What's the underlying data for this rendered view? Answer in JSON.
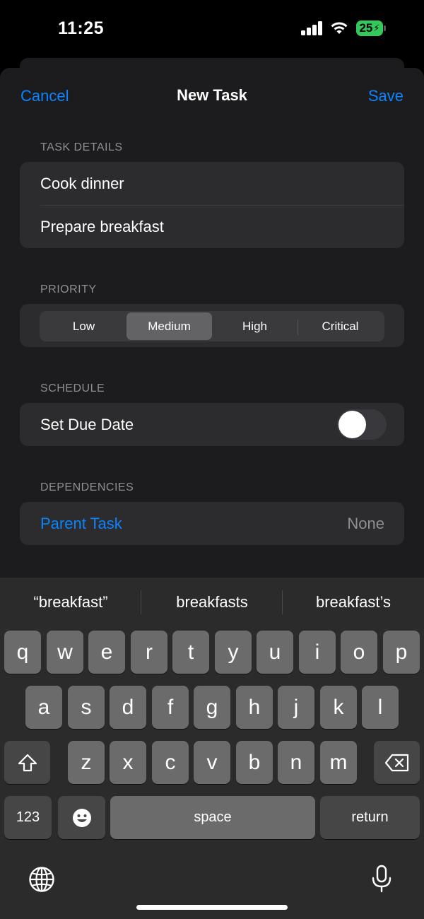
{
  "status": {
    "time": "11:25",
    "battery": "25"
  },
  "nav": {
    "cancel": "Cancel",
    "title": "New Task",
    "save": "Save"
  },
  "task_details": {
    "header": "TASK DETAILS",
    "fields": [
      "Cook dinner",
      "Prepare breakfast"
    ]
  },
  "priority": {
    "header": "PRIORITY",
    "options": [
      "Low",
      "Medium",
      "High",
      "Critical"
    ],
    "selected": "Medium"
  },
  "schedule": {
    "header": "SCHEDULE",
    "due_label": "Set Due Date",
    "due_enabled": false
  },
  "dependencies": {
    "header": "DEPENDENCIES",
    "parent_label": "Parent Task",
    "parent_value": "None"
  },
  "keyboard": {
    "suggestions": [
      "“breakfast”",
      "breakfasts",
      "breakfast’s"
    ],
    "row1": [
      "q",
      "w",
      "e",
      "r",
      "t",
      "y",
      "u",
      "i",
      "o",
      "p"
    ],
    "row2": [
      "a",
      "s",
      "d",
      "f",
      "g",
      "h",
      "j",
      "k",
      "l"
    ],
    "row3": [
      "z",
      "x",
      "c",
      "v",
      "b",
      "n",
      "m"
    ],
    "numbers_key": "123",
    "space_key": "space",
    "return_key": "return"
  },
  "icons": [
    "signal-icon",
    "wifi-icon",
    "battery-icon",
    "shift-icon",
    "delete-icon",
    "emoji-icon",
    "globe-icon",
    "microphone-icon"
  ]
}
